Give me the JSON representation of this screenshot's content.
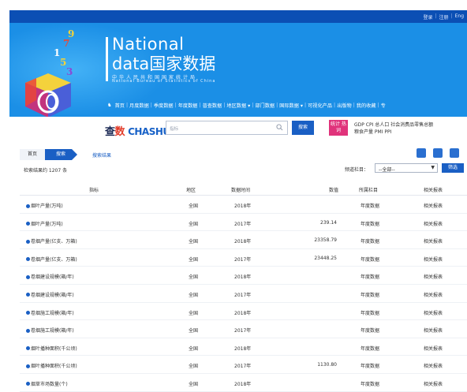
{
  "topbar": {
    "links": [
      "登录",
      "注册",
      "Eng"
    ]
  },
  "banner": {
    "logo_en_line1": "National",
    "logo_en_line2": "data国家数据",
    "logo_cn_small": "中华人民共和国国家统计局",
    "logo_en_small": "National Bureau of Statistics of China",
    "cube_numbers": [
      "9",
      "7",
      "1",
      "5",
      "3"
    ]
  },
  "nav": {
    "items": [
      "首页",
      "月度数据",
      "季度数据",
      "年度数据",
      "普查数据",
      "地区数据 ▾",
      "部门数据",
      "国际数据 ▾",
      "可视化产品",
      "出版物",
      "我的收藏",
      "专"
    ]
  },
  "search": {
    "brand_cn": "查",
    "brand_num": "数",
    "brand_en": "CHASHU",
    "placeholder": "指标",
    "button": "搜索",
    "tag": "统计 热词",
    "hot_line1": "GDP  CPI  总人口  社会消费品零售总额",
    "hot_line2": "粮食产量  PMI  PPI"
  },
  "breadcrumb": {
    "home": "首页",
    "current": "搜索",
    "link": "搜索结果"
  },
  "results": {
    "count_text": "检索结果约 1207 条",
    "filter_label": "频道栏目：",
    "filter_value": "--全部--",
    "filter_button": "筛选"
  },
  "table": {
    "headers": [
      "指标",
      "地区",
      "数据时间",
      "数值",
      "所属栏目",
      "相关报表"
    ],
    "rows": [
      {
        "indicator": "烟叶产量(万吨)",
        "region": "全国",
        "time": "2018年",
        "value": "",
        "column": "年度数据",
        "report": "相关报表"
      },
      {
        "indicator": "烟叶产量(万吨)",
        "region": "全国",
        "time": "2017年",
        "value": "239.14",
        "column": "年度数据",
        "report": "相关报表"
      },
      {
        "indicator": "卷烟产量(亿支、万箱)",
        "region": "全国",
        "time": "2018年",
        "value": "23358.79",
        "column": "年度数据",
        "report": "相关报表"
      },
      {
        "indicator": "卷烟产量(亿支、万箱)",
        "region": "全国",
        "time": "2017年",
        "value": "23448.25",
        "column": "年度数据",
        "report": "相关报表"
      },
      {
        "indicator": "卷烟建设规模(箱/年)",
        "region": "全国",
        "time": "2018年",
        "value": "",
        "column": "年度数据",
        "report": "相关报表"
      },
      {
        "indicator": "卷烟建设规模(箱/年)",
        "region": "全国",
        "time": "2017年",
        "value": "",
        "column": "年度数据",
        "report": "相关报表"
      },
      {
        "indicator": "卷烟施工规模(箱/年)",
        "region": "全国",
        "time": "2018年",
        "value": "",
        "column": "年度数据",
        "report": "相关报表"
      },
      {
        "indicator": "卷烟施工规模(箱/年)",
        "region": "全国",
        "time": "2017年",
        "value": "",
        "column": "年度数据",
        "report": "相关报表"
      },
      {
        "indicator": "烟叶播种面积(千公顷)",
        "region": "全国",
        "time": "2018年",
        "value": "",
        "column": "年度数据",
        "report": "相关报表"
      },
      {
        "indicator": "烟叶播种面积(千公顷)",
        "region": "全国",
        "time": "2017年",
        "value": "1130.80",
        "column": "年度数据",
        "report": "相关报表"
      },
      {
        "indicator": "烟草市场数量(个)",
        "region": "全国",
        "time": "2018年",
        "value": "",
        "column": "年度数据",
        "report": "相关报表"
      }
    ]
  },
  "colors": {
    "topbar": "#0b4fb4",
    "banner": "#1b8fe6",
    "accent": "#1a5fc4",
    "tag": "#e0337b"
  }
}
